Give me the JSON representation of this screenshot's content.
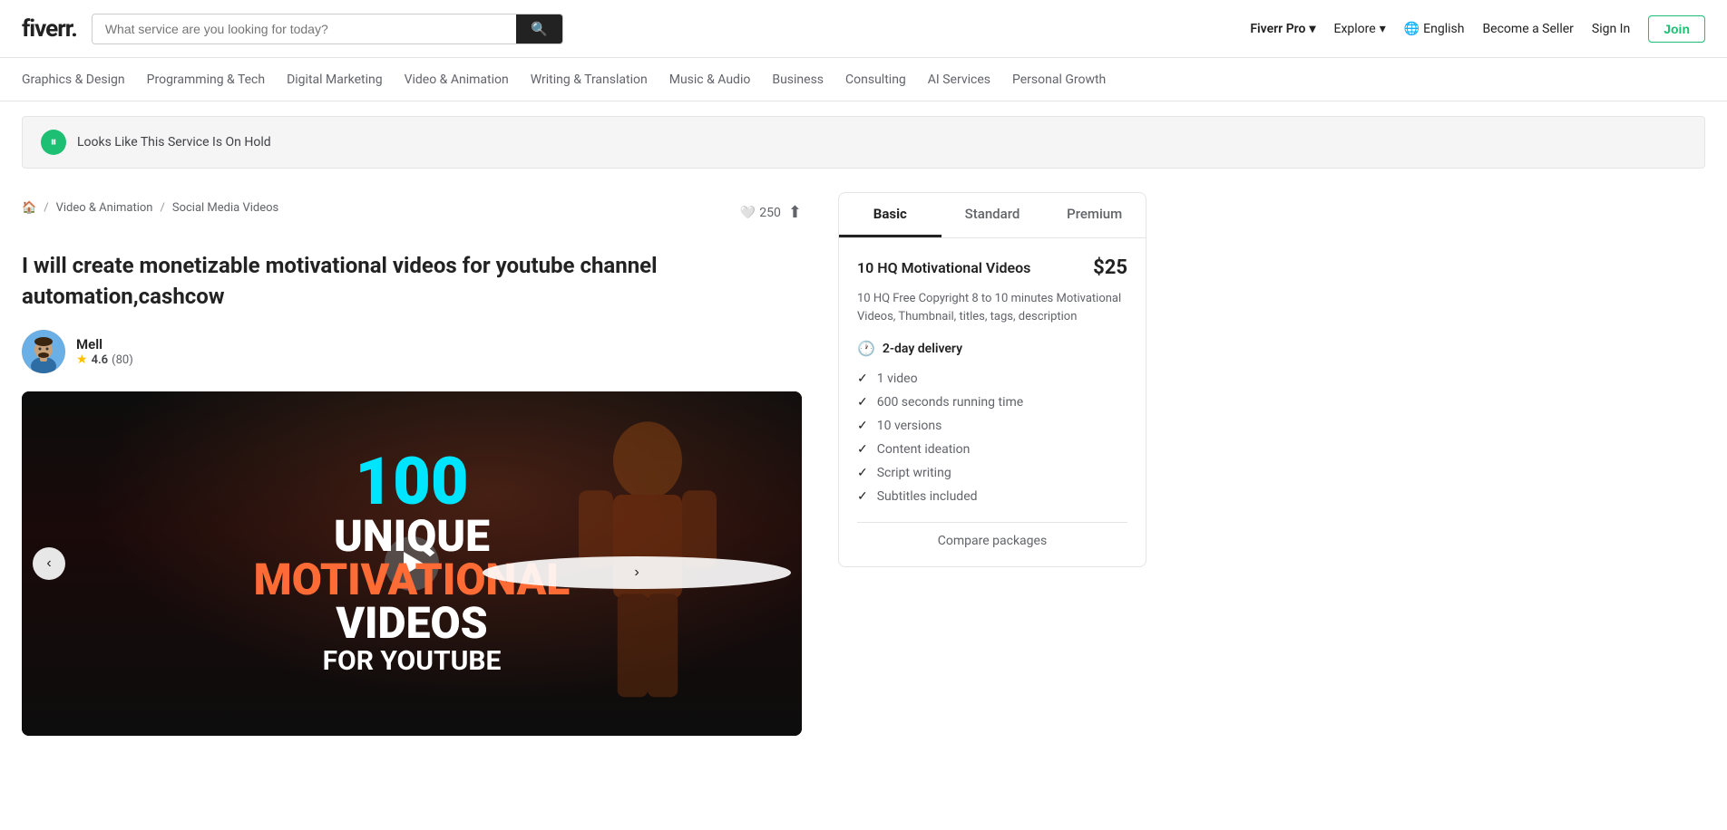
{
  "header": {
    "logo_text": "fiverr.",
    "search_placeholder": "What service are you looking for today?",
    "fiverr_pro_label": "Fiverr Pro",
    "explore_label": "Explore",
    "lang_label": "English",
    "become_seller_label": "Become a Seller",
    "sign_in_label": "Sign In",
    "join_label": "Join"
  },
  "nav": {
    "items": [
      "Graphics & Design",
      "Programming & Tech",
      "Digital Marketing",
      "Video & Animation",
      "Writing & Translation",
      "Music & Audio",
      "Business",
      "Consulting",
      "AI Services",
      "Personal Growth"
    ]
  },
  "banner": {
    "text": "Looks Like This Service Is On Hold"
  },
  "breadcrumb": {
    "home_icon": "🏠",
    "video_animation": "Video & Animation",
    "social_media": "Social Media Videos"
  },
  "likes": {
    "count": "250"
  },
  "gig": {
    "title": "I will create monetizable motivational videos for youtube channel automation,cashcow",
    "seller_name": "Mell",
    "rating_value": "4.6",
    "review_count": "80",
    "video_overlay": {
      "line1": "100",
      "line2": "UNIQUE",
      "line3": "MOTIVATIONAL",
      "line4": "VIDEOS",
      "line5": "FOR YOUTUBE"
    }
  },
  "slider": {
    "prev_label": "‹",
    "next_label": "›"
  },
  "package": {
    "tabs": [
      {
        "label": "Basic",
        "active": true
      },
      {
        "label": "Standard",
        "active": false
      },
      {
        "label": "Premium",
        "active": false
      }
    ],
    "title": "10 HQ Motivational Videos",
    "price": "$25",
    "description": "10 HQ Free Copyright 8 to 10 minutes Motivational Videos, Thumbnail, titles, tags, description",
    "delivery": "2-day delivery",
    "features": [
      "1 video",
      "600 seconds running time",
      "10 versions",
      "Content ideation",
      "Script writing",
      "Subtitles included"
    ],
    "compare_label": "Compare packages"
  }
}
